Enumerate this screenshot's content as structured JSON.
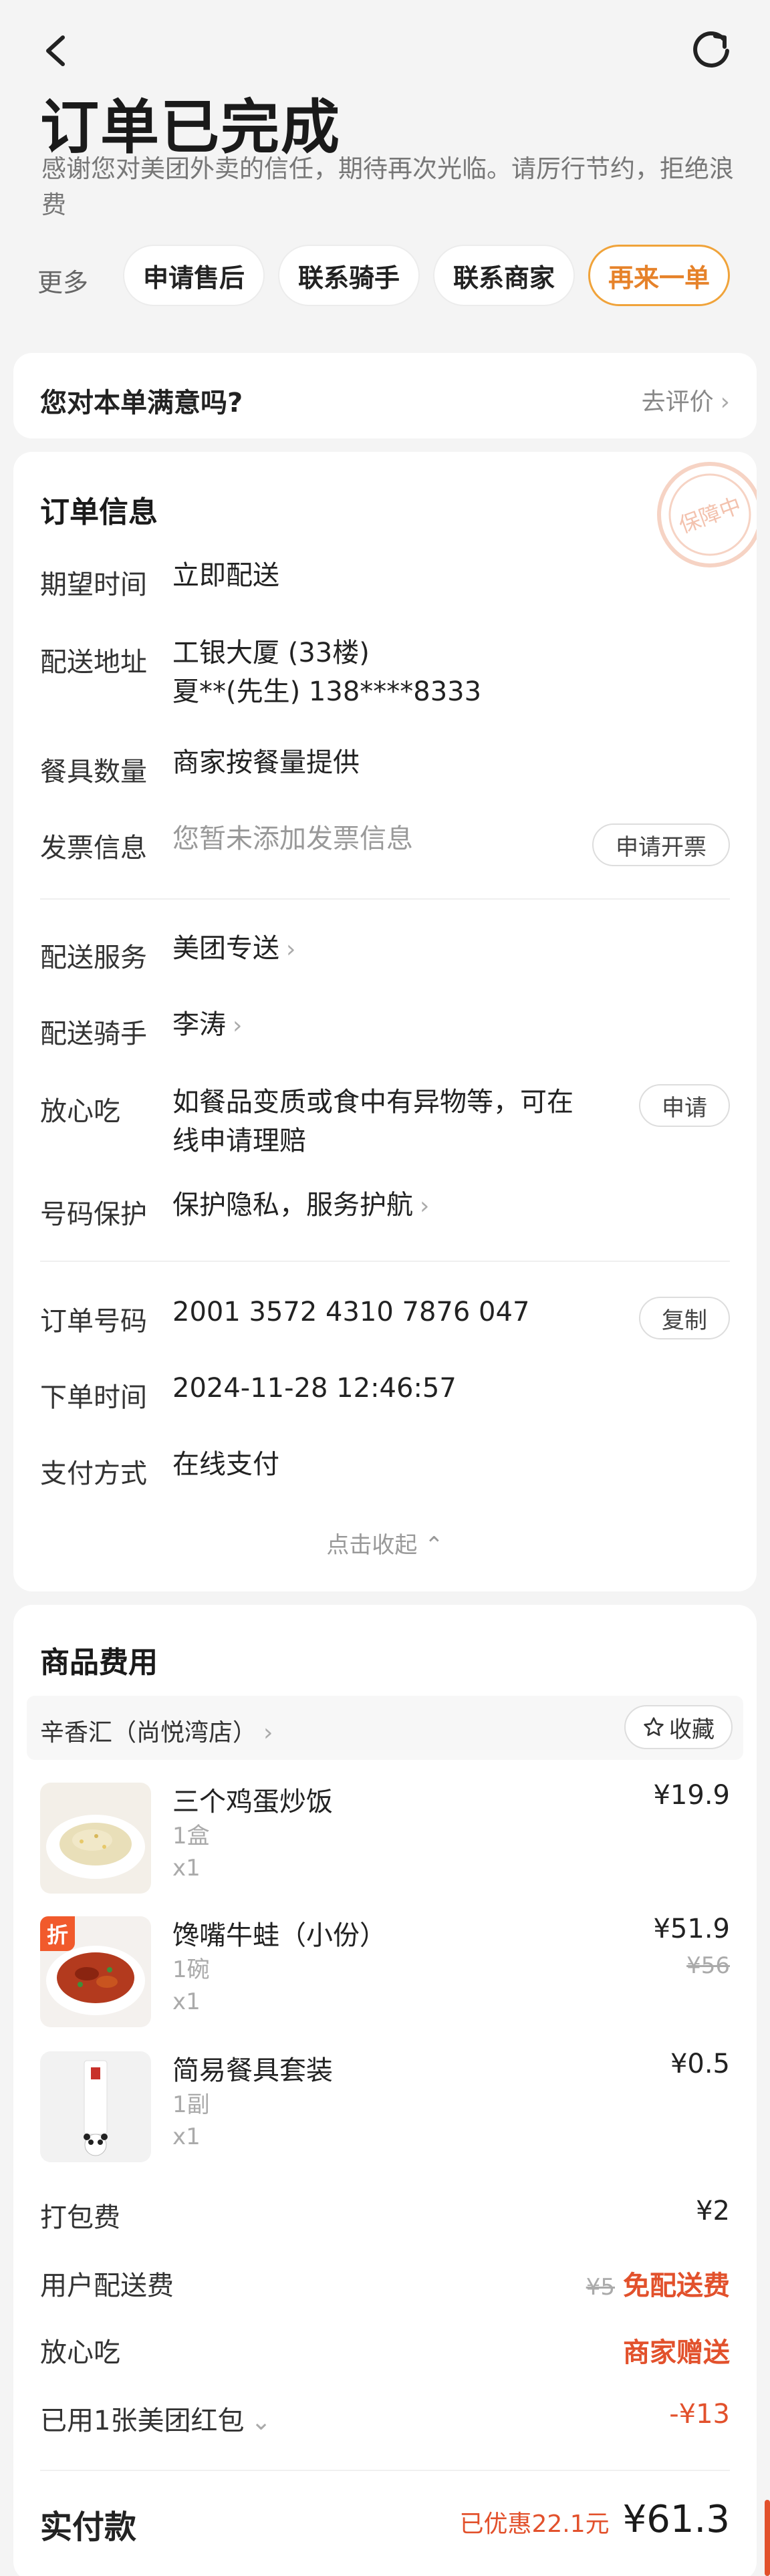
{
  "header": {
    "title": "订单已完成",
    "subtitle": "感谢您对美团外卖的信任，期待再次光临。请厉行节约，拒绝浪费",
    "more_label": "更多",
    "actions": [
      "申请售后",
      "联系骑手",
      "联系商家",
      "再来一单"
    ]
  },
  "satisfaction": {
    "question": "您对本单满意吗?",
    "link": "去评价"
  },
  "order_info": {
    "title": "订单信息",
    "stamp_text": "保障中",
    "expected_time": {
      "label": "期望时间",
      "value": "立即配送"
    },
    "address": {
      "label": "配送地址",
      "line1": "工银大厦 (33楼)",
      "line2": "夏**(先生) 138****8333"
    },
    "tableware": {
      "label": "餐具数量",
      "value": "商家按餐量提供"
    },
    "invoice": {
      "label": "发票信息",
      "value": "您暂未添加发票信息",
      "button": "申请开票"
    },
    "delivery_service": {
      "label": "配送服务",
      "value": "美团专送"
    },
    "rider": {
      "label": "配送骑手",
      "value": "李涛"
    },
    "safe_eat": {
      "label": "放心吃",
      "value_line1": "如餐品变质或食中有异物等，可在",
      "value_line2": "线申请理赔",
      "button": "申请"
    },
    "number_protect": {
      "label": "号码保护",
      "value": "保护隐私，服务护航"
    },
    "order_number": {
      "label": "订单号码",
      "value": "2001 3572 4310 7876 047",
      "button": "复制"
    },
    "order_time": {
      "label": "下单时间",
      "value": "2024-11-28 12:46:57"
    },
    "payment": {
      "label": "支付方式",
      "value": "在线支付"
    },
    "collapse": "点击收起"
  },
  "goods": {
    "title": "商品费用",
    "store_name": "辛香汇（尚悦湾店）",
    "favorite": "收藏",
    "discount_tag": "折",
    "items": [
      {
        "name": "三个鸡蛋炒饭",
        "unit": "1盒",
        "qty": "x1",
        "price": "¥19.9"
      },
      {
        "name": "馋嘴牛蛙（小份）",
        "unit": "1碗",
        "qty": "x1",
        "price": "¥51.9",
        "original": "¥56"
      },
      {
        "name": "简易餐具套装",
        "unit": "1副",
        "qty": "x1",
        "price": "¥0.5"
      }
    ],
    "packing": {
      "label": "打包费",
      "value": "¥2"
    },
    "delivery_fee": {
      "label": "用户配送费",
      "original": "¥5",
      "value": "免配送费"
    },
    "safe_eat": {
      "label": "放心吃",
      "value": "商家赠送"
    },
    "red_packet": {
      "label": "已用1张美团红包",
      "value": "-¥13"
    },
    "total": {
      "label": "实付款",
      "discount": "已优惠22.1元",
      "value": "¥61.3"
    }
  },
  "colors": {
    "accent": "#e6822a",
    "red": "#e2512c",
    "background": "#f4f4f4"
  }
}
